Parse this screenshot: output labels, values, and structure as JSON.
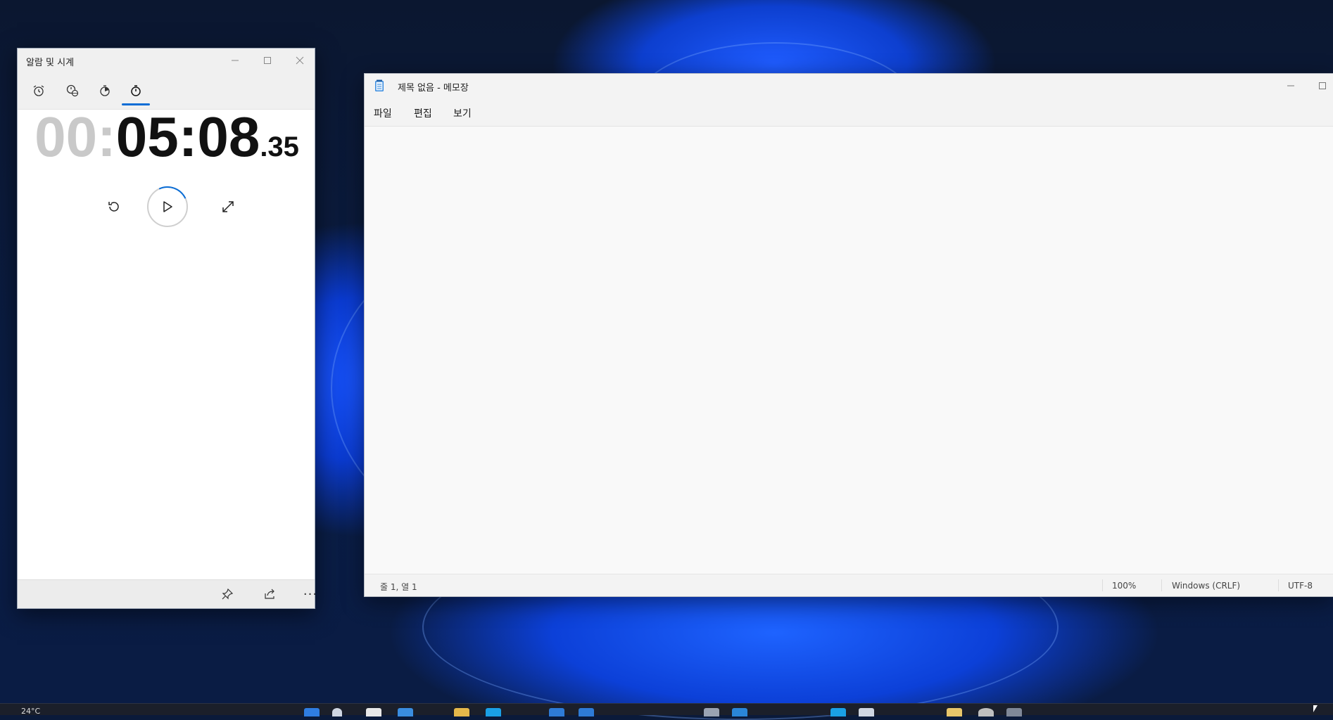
{
  "clock_app": {
    "title": "알람 및 시계",
    "tabs": [
      {
        "icon": "alarm-icon"
      },
      {
        "icon": "world-clock-icon"
      },
      {
        "icon": "timer-icon"
      },
      {
        "icon": "stopwatch-icon"
      }
    ],
    "active_tab_index": 3,
    "stopwatch": {
      "hours": "00",
      "hours_sep": ":",
      "minutes_seconds": "05:08",
      "centiseconds": ".35"
    },
    "controls": {
      "reset_icon": "reset-icon",
      "play_icon": "play-icon",
      "expand_icon": "expand-icon"
    },
    "footer": {
      "pin_icon": "pin-icon",
      "share_icon": "share-icon",
      "more_label": "···"
    },
    "accent_color": "#0a6dd6"
  },
  "notepad": {
    "title": "제목 없음 - 메모장",
    "menu": [
      "파일",
      "편집",
      "보기"
    ],
    "content": "",
    "status": {
      "position": "줄 1, 열 1",
      "zoom": "100%",
      "line_ending": "Windows (CRLF)",
      "encoding": "UTF-8"
    }
  },
  "taskbar": {
    "weather": "24°C"
  }
}
